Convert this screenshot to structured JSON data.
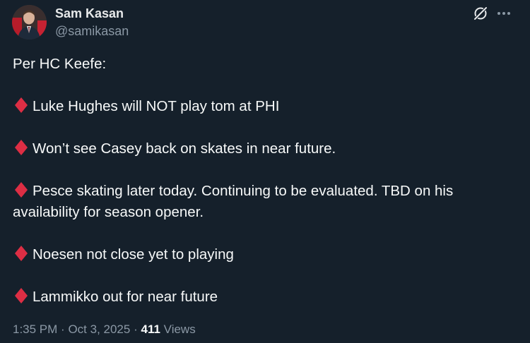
{
  "author": {
    "name": "Sam Kasan",
    "handle": "@samikasan"
  },
  "icons": {
    "grok": "grok-icon",
    "more": "more-options-icon",
    "bullet": "red-diamond-icon",
    "bullet_color": "#dd2e44"
  },
  "tweet": {
    "intro": "Per HC Keefe:",
    "items": [
      {
        "lines": [
          "Luke Hughes will NOT play tom at PHI"
        ]
      },
      {
        "lines": [
          "Won’t see Casey back on skates in near future."
        ]
      },
      {
        "lines": [
          "Pesce skating later today. Continuing to be evaluated. TBD on his",
          "availability for season opener."
        ]
      },
      {
        "lines": [
          "Noesen not close yet to playing"
        ]
      },
      {
        "lines": [
          "Lammikko out for near future"
        ]
      }
    ]
  },
  "meta": {
    "time": "1:35 PM",
    "separator": "·",
    "date": "Oct 3, 2025",
    "views_count": "411",
    "views_label": "Views"
  },
  "colors": {
    "background": "#15202b",
    "text": "#f7f9f9",
    "secondary": "#8b98a5"
  }
}
